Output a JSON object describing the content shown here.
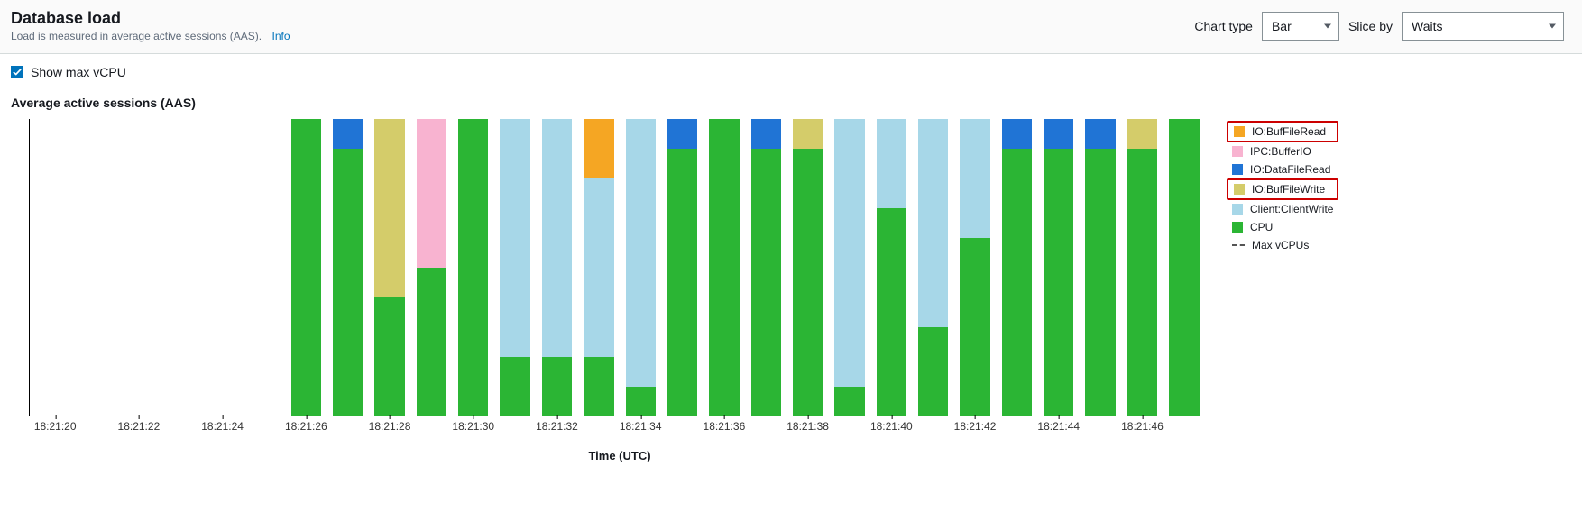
{
  "header": {
    "title": "Database load",
    "subtitle": "Load is measured in average active sessions (AAS).",
    "info_label": "Info",
    "chart_type_label": "Chart type",
    "chart_type_value": "Bar",
    "slice_by_label": "Slice by",
    "slice_by_value": "Waits"
  },
  "options": {
    "show_max_vcpu_label": "Show max vCPU",
    "show_max_vcpu_checked": true
  },
  "chart": {
    "title": "Average active sessions (AAS)",
    "xlabel": "Time (UTC)",
    "x_tick_labels": [
      "18:21:20",
      "18:21:22",
      "18:21:24",
      "18:21:26",
      "18:21:28",
      "18:21:30",
      "18:21:32",
      "18:21:34",
      "18:21:36",
      "18:21:38",
      "18:21:40",
      "18:21:42",
      "18:21:44",
      "18:21:46"
    ]
  },
  "legend": [
    {
      "key": "IO:BufFileRead",
      "color": "#f5a623",
      "highlight": true
    },
    {
      "key": "IPC:BufferIO",
      "color": "#f8b3d0"
    },
    {
      "key": "IO:DataFileRead",
      "color": "#2074d5"
    },
    {
      "key": "IO:BufFileWrite",
      "color": "#d4cc6a",
      "highlight": true
    },
    {
      "key": "Client:ClientWrite",
      "color": "#a7d7e8"
    },
    {
      "key": "CPU",
      "color": "#2bb534"
    },
    {
      "key": "Max vCPUs",
      "dash": true
    }
  ],
  "chart_data": {
    "type": "bar",
    "title": "Average active sessions (AAS)",
    "xlabel": "Time (UTC)",
    "ylabel": "",
    "ylim": [
      0,
      1.0
    ],
    "stack_order": [
      "CPU",
      "Client:ClientWrite",
      "IO:BufFileWrite",
      "IO:DataFileRead",
      "IPC:BufferIO",
      "IO:BufFileRead"
    ],
    "categories_seconds": [
      20,
      21,
      22,
      23,
      24,
      25,
      26,
      27,
      28,
      29,
      30,
      31,
      32,
      33,
      34,
      35,
      36,
      37,
      38,
      39,
      40,
      41,
      42,
      43,
      44,
      45,
      46,
      47
    ],
    "series": [
      {
        "name": "CPU",
        "color": "#2bb534",
        "values": [
          0,
          0,
          0,
          0,
          0,
          0,
          1.0,
          0.9,
          0.4,
          0.5,
          1.0,
          0.2,
          0.2,
          0.2,
          0.1,
          0.9,
          1.0,
          0.9,
          0.9,
          0.1,
          0.7,
          0.3,
          0.6,
          0.9,
          0.9,
          0.9,
          0.9,
          1.0
        ]
      },
      {
        "name": "Client:ClientWrite",
        "color": "#a7d7e8",
        "values": [
          0,
          0,
          0,
          0,
          0,
          0,
          0,
          0,
          0,
          0,
          0,
          0.8,
          0.8,
          0.6,
          0.9,
          0,
          0,
          0,
          0,
          0.9,
          0.3,
          0.7,
          0.4,
          0,
          0,
          0,
          0,
          0
        ]
      },
      {
        "name": "IO:BufFileWrite",
        "color": "#d4cc6a",
        "values": [
          0,
          0,
          0,
          0,
          0,
          0,
          0,
          0,
          0.6,
          0,
          0,
          0,
          0,
          0,
          0,
          0,
          0,
          0,
          0.1,
          0,
          0,
          0,
          0,
          0,
          0,
          0,
          0.1,
          0
        ]
      },
      {
        "name": "IO:DataFileRead",
        "color": "#2074d5",
        "values": [
          0,
          0,
          0,
          0,
          0,
          0,
          0,
          0.1,
          0,
          0,
          0,
          0,
          0,
          0,
          0,
          0.1,
          0,
          0.1,
          0,
          0,
          0,
          0,
          0,
          0.1,
          0.1,
          0.1,
          0,
          0
        ]
      },
      {
        "name": "IPC:BufferIO",
        "color": "#f8b3d0",
        "values": [
          0,
          0,
          0,
          0,
          0,
          0,
          0,
          0,
          0,
          0.5,
          0,
          0,
          0,
          0,
          0,
          0,
          0,
          0,
          0,
          0,
          0,
          0,
          0,
          0,
          0,
          0,
          0,
          0
        ]
      },
      {
        "name": "IO:BufFileRead",
        "color": "#f5a623",
        "values": [
          0,
          0,
          0,
          0,
          0,
          0,
          0,
          0,
          0,
          0,
          0,
          0,
          0,
          0.2,
          0,
          0,
          0,
          0,
          0,
          0,
          0,
          0,
          0,
          0,
          0,
          0,
          0,
          0
        ]
      }
    ],
    "max_vcpus_line": null
  }
}
